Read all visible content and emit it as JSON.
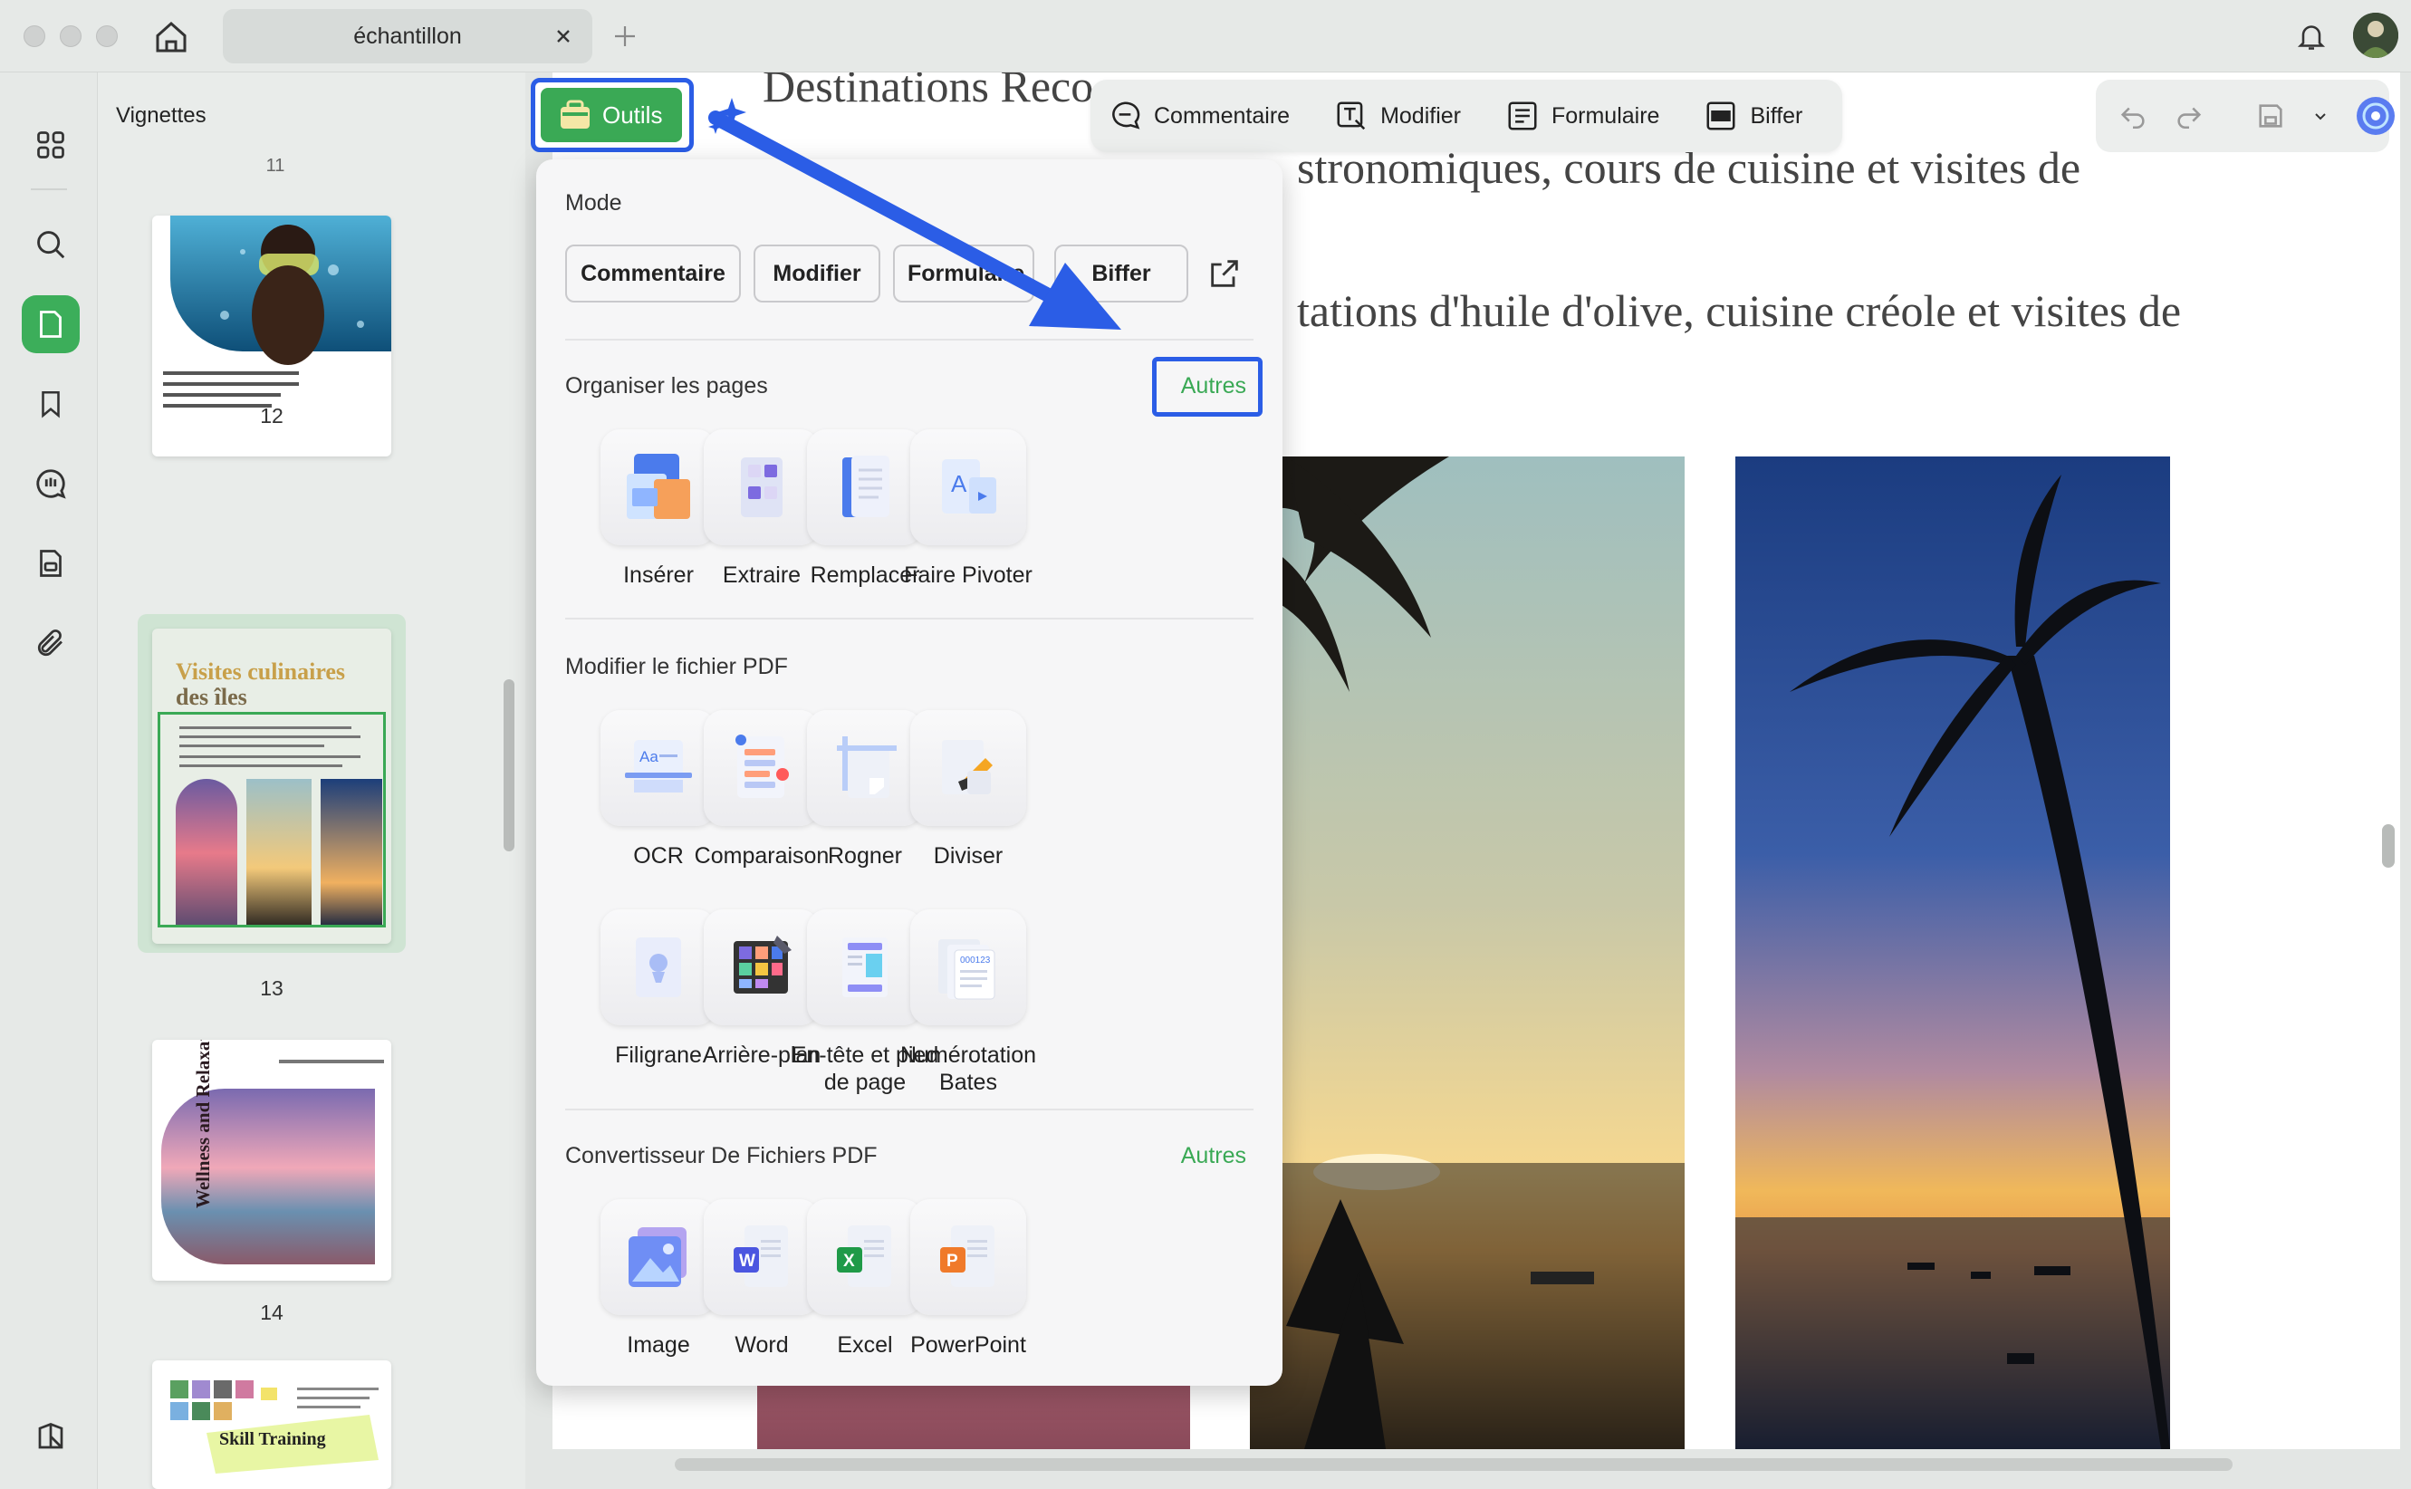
{
  "window": {
    "tab_title": "échantillon"
  },
  "sidebar": {
    "title": "Vignettes",
    "pages": [
      {
        "number": "11"
      },
      {
        "number": "12"
      },
      {
        "number": "13"
      },
      {
        "number": "14"
      }
    ],
    "thumb13_title_line1": "Visites culinaires",
    "thumb13_title_line2": "des îles",
    "thumb14_text": "Wellness and Relaxation",
    "thumb15_text": "Skill Training"
  },
  "toolbar": {
    "outils": "Outils",
    "items": [
      "Commentaire",
      "Modifier",
      "Formulaire",
      "Biffer"
    ]
  },
  "document": {
    "line1": "Destinations Reco",
    "line2": "stronomiques, cours de cuisine et visites de",
    "line3": "tations d'huile d'olive, cuisine créole et visites de"
  },
  "tools_panel": {
    "mode_title": "Mode",
    "mode_buttons": [
      "Commentaire",
      "Modifier",
      "Formulaire",
      "Biffer"
    ],
    "organize": {
      "title": "Organiser les pages",
      "more": "Autres",
      "tools": [
        "Insérer",
        "Extraire",
        "Remplacer",
        "Faire Pivoter"
      ]
    },
    "modify": {
      "title": "Modifier le fichier PDF",
      "tools": [
        "OCR",
        "Comparaison",
        "Rogner",
        "Diviser",
        "Filigrane",
        "Arrière-plan",
        "En-tête et pied de page",
        "Numérotation Bates"
      ]
    },
    "convert": {
      "title": "Convertisseur De Fichiers PDF",
      "more": "Autres",
      "tools": [
        "Image",
        "Word",
        "Excel",
        "PowerPoint"
      ]
    }
  },
  "colors": {
    "accent_green": "#3aa955",
    "highlight_blue": "#2b5de6"
  }
}
